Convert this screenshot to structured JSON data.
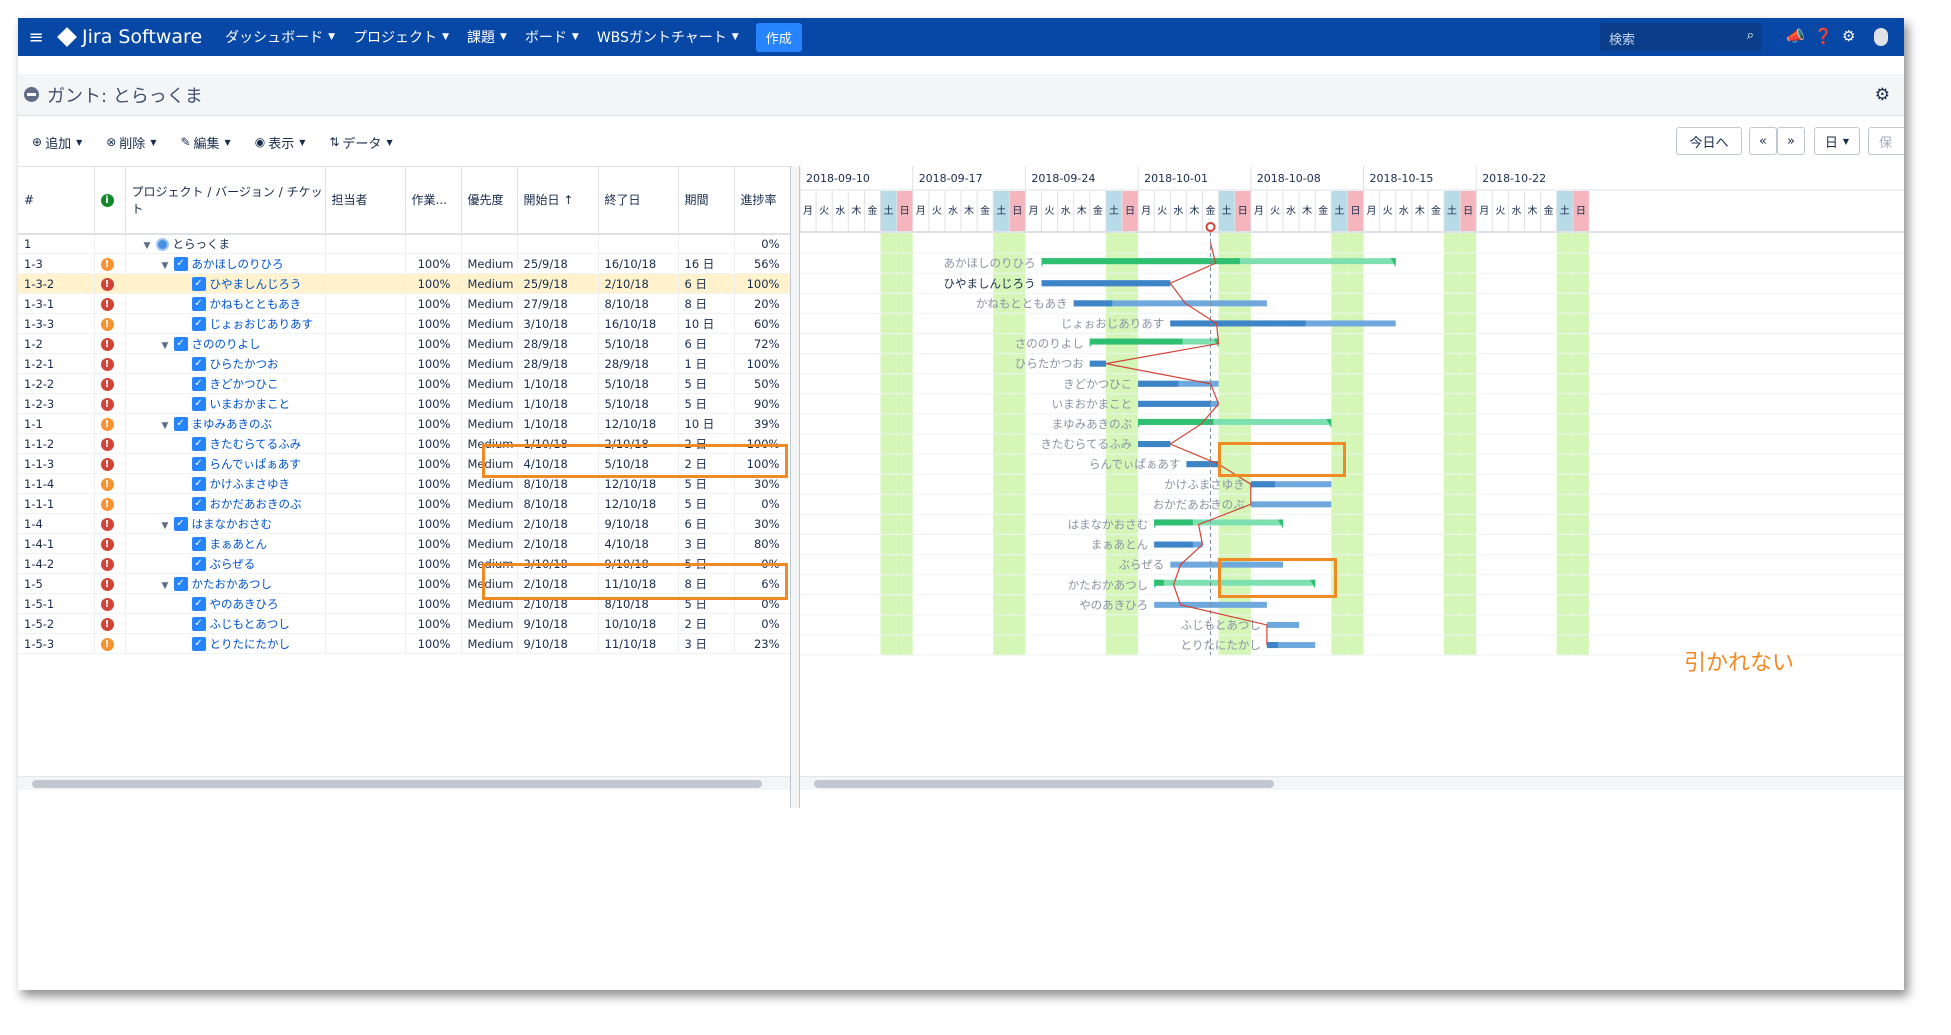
{
  "nav": {
    "app_name": "Jira Software",
    "menus": [
      "ダッシュボード",
      "プロジェクト",
      "課題",
      "ボード",
      "WBSガントチャート"
    ],
    "create_label": "作成",
    "search_placeholder": "検索"
  },
  "page": {
    "title": "ガント:  とらっくま"
  },
  "toolbar": {
    "buttons": [
      "追加",
      "削除",
      "編集",
      "表示",
      "データ"
    ],
    "today_label": "今日へ",
    "prev_label": "«",
    "next_label": "»",
    "scale_label": "日",
    "save_label": "保"
  },
  "grid": {
    "columns": [
      "#",
      "",
      "プロジェクト / バージョン / チケット",
      "担当者",
      "作業...",
      "優先度",
      "開始日",
      "終了日",
      "期間",
      "進捗率"
    ],
    "sort_indicator": "↑",
    "rows": [
      {
        "id": "1",
        "level": 0,
        "type": "project",
        "name": "とらっくま",
        "work": "",
        "priority": "",
        "start": "",
        "end": "",
        "duration": "",
        "progress": "0%",
        "prio": "none",
        "selected": false
      },
      {
        "id": "1-3",
        "level": 1,
        "type": "version",
        "name": "あかほしのりひろ",
        "work": "100%",
        "priority": "Medium",
        "start": "25/9/18",
        "end": "16/10/18",
        "duration": "16 日",
        "progress": "56%",
        "prio": "org",
        "selected": false
      },
      {
        "id": "1-3-2",
        "level": 2,
        "type": "task",
        "name": "ひやましんじろう",
        "work": "100%",
        "priority": "Medium",
        "start": "25/9/18",
        "end": "2/10/18",
        "duration": "6 日",
        "progress": "100%",
        "prio": "red",
        "selected": true
      },
      {
        "id": "1-3-1",
        "level": 2,
        "type": "task",
        "name": "かねもとともあき",
        "work": "100%",
        "priority": "Medium",
        "start": "27/9/18",
        "end": "8/10/18",
        "duration": "8 日",
        "progress": "20%",
        "prio": "red",
        "selected": false
      },
      {
        "id": "1-3-3",
        "level": 2,
        "type": "task",
        "name": "じょぉおじありあす",
        "work": "100%",
        "priority": "Medium",
        "start": "3/10/18",
        "end": "16/10/18",
        "duration": "10 日",
        "progress": "60%",
        "prio": "org",
        "selected": false
      },
      {
        "id": "1-2",
        "level": 1,
        "type": "version",
        "name": "さののりよし",
        "work": "100%",
        "priority": "Medium",
        "start": "28/9/18",
        "end": "5/10/18",
        "duration": "6 日",
        "progress": "72%",
        "prio": "red",
        "selected": false
      },
      {
        "id": "1-2-1",
        "level": 2,
        "type": "task",
        "name": "ひらたかつお",
        "work": "100%",
        "priority": "Medium",
        "start": "28/9/18",
        "end": "28/9/18",
        "duration": "1 日",
        "progress": "100%",
        "prio": "red",
        "selected": false
      },
      {
        "id": "1-2-2",
        "level": 2,
        "type": "task",
        "name": "きどかつひこ",
        "work": "100%",
        "priority": "Medium",
        "start": "1/10/18",
        "end": "5/10/18",
        "duration": "5 日",
        "progress": "50%",
        "prio": "red",
        "selected": false
      },
      {
        "id": "1-2-3",
        "level": 2,
        "type": "task",
        "name": "いまおかまこと",
        "work": "100%",
        "priority": "Medium",
        "start": "1/10/18",
        "end": "5/10/18",
        "duration": "5 日",
        "progress": "90%",
        "prio": "red",
        "selected": false
      },
      {
        "id": "1-1",
        "level": 1,
        "type": "version",
        "name": "まゆみあきのぶ",
        "work": "100%",
        "priority": "Medium",
        "start": "1/10/18",
        "end": "12/10/18",
        "duration": "10 日",
        "progress": "39%",
        "prio": "org",
        "selected": false
      },
      {
        "id": "1-1-2",
        "level": 2,
        "type": "task",
        "name": "きたむらてるふみ",
        "work": "100%",
        "priority": "Medium",
        "start": "1/10/18",
        "end": "2/10/18",
        "duration": "2 日",
        "progress": "100%",
        "prio": "red",
        "selected": false
      },
      {
        "id": "1-1-3",
        "level": 2,
        "type": "task",
        "name": "らんでぃぱぁあす",
        "work": "100%",
        "priority": "Medium",
        "start": "4/10/18",
        "end": "5/10/18",
        "duration": "2 日",
        "progress": "100%",
        "prio": "red",
        "selected": false
      },
      {
        "id": "1-1-4",
        "level": 2,
        "type": "task",
        "name": "かけふまさゆき",
        "work": "100%",
        "priority": "Medium",
        "start": "8/10/18",
        "end": "12/10/18",
        "duration": "5 日",
        "progress": "30%",
        "prio": "org",
        "selected": false
      },
      {
        "id": "1-1-1",
        "level": 2,
        "type": "task",
        "name": "おかだあおきのぶ",
        "work": "100%",
        "priority": "Medium",
        "start": "8/10/18",
        "end": "12/10/18",
        "duration": "5 日",
        "progress": "0%",
        "prio": "org",
        "selected": false
      },
      {
        "id": "1-4",
        "level": 1,
        "type": "version",
        "name": "はまなかおさむ",
        "work": "100%",
        "priority": "Medium",
        "start": "2/10/18",
        "end": "9/10/18",
        "duration": "6 日",
        "progress": "30%",
        "prio": "red",
        "selected": false
      },
      {
        "id": "1-4-1",
        "level": 2,
        "type": "task",
        "name": "まぁあとん",
        "work": "100%",
        "priority": "Medium",
        "start": "2/10/18",
        "end": "4/10/18",
        "duration": "3 日",
        "progress": "80%",
        "prio": "red",
        "selected": false
      },
      {
        "id": "1-4-2",
        "level": 2,
        "type": "task",
        "name": "ぶらぜる",
        "work": "100%",
        "priority": "Medium",
        "start": "3/10/18",
        "end": "9/10/18",
        "duration": "5 日",
        "progress": "0%",
        "prio": "red",
        "selected": false
      },
      {
        "id": "1-5",
        "level": 1,
        "type": "version",
        "name": "かたおかあつし",
        "work": "100%",
        "priority": "Medium",
        "start": "2/10/18",
        "end": "11/10/18",
        "duration": "8 日",
        "progress": "6%",
        "prio": "red",
        "selected": false
      },
      {
        "id": "1-5-1",
        "level": 2,
        "type": "task",
        "name": "やのあきひろ",
        "work": "100%",
        "priority": "Medium",
        "start": "2/10/18",
        "end": "8/10/18",
        "duration": "5 日",
        "progress": "0%",
        "prio": "red",
        "selected": false
      },
      {
        "id": "1-5-2",
        "level": 2,
        "type": "task",
        "name": "ふじもとあつし",
        "work": "100%",
        "priority": "Medium",
        "start": "9/10/18",
        "end": "10/10/18",
        "duration": "2 日",
        "progress": "0%",
        "prio": "red",
        "selected": false
      },
      {
        "id": "1-5-3",
        "level": 2,
        "type": "task",
        "name": "とりたにたかし",
        "work": "100%",
        "priority": "Medium",
        "start": "9/10/18",
        "end": "11/10/18",
        "duration": "3 日",
        "progress": "23%",
        "prio": "org",
        "selected": false
      }
    ]
  },
  "gantt": {
    "weeks": [
      "2018-09-10",
      "2018-09-17",
      "2018-09-24",
      "2018-10-01",
      "2018-10-08",
      "2018-10-15",
      "2018-10-22"
    ],
    "weekdays": [
      "月",
      "火",
      "水",
      "木",
      "金",
      "土",
      "日"
    ],
    "first_day": "2018-09-10",
    "today": "2018-10-05",
    "bar_labels": [
      "あかほしのりひろ",
      "ひやましんじろう",
      "かねもとともあき",
      "じょぉおじありあす",
      "さののりよし",
      "ひらたかつお",
      "きどかつひこ",
      "いまおかまこと",
      "まゆみあきのぶ",
      "きたむらてるふみ",
      "らんでぃぱぁあす",
      "かけふまさゆき",
      "おかだあおきのぶ",
      "はまなかおさむ",
      "まぁあとん",
      "ぶらぜる",
      "かたおかあつし",
      "やのあきひろ",
      "ふじもとあつし",
      "とりたにたかし"
    ]
  },
  "annotation": {
    "text": "引かれない",
    "color": "#f08a24"
  },
  "colors": {
    "nav": "#0747a6",
    "create": "#2684ff",
    "weekend": "#d4f7b8",
    "today_line": "#d04437",
    "task_bar": "#6fa8dc",
    "version_bar": "#7ee0b0",
    "version_progress": "#2fbf71"
  }
}
